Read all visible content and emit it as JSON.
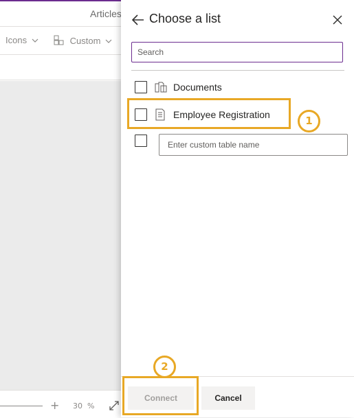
{
  "app": {
    "title": "Articles",
    "toolbar": {
      "icons_label": "Icons",
      "custom_label": "Custom"
    },
    "zoom": {
      "value": "30",
      "unit": "%"
    }
  },
  "panel": {
    "title": "Choose a list",
    "search_placeholder": "Search",
    "items": [
      {
        "label": "Documents",
        "icon": "library-icon",
        "checked": false
      },
      {
        "label": "Employee Registration",
        "icon": "list-icon",
        "checked": false
      }
    ],
    "custom_table_placeholder": "Enter custom table name",
    "connect_label": "Connect",
    "cancel_label": "Cancel"
  },
  "annotations": {
    "callout_1": "1",
    "callout_2": "2",
    "highlight_color": "#e8a825"
  },
  "colors": {
    "accent": "#6b2c8f",
    "canvas": "#ebebeb"
  }
}
